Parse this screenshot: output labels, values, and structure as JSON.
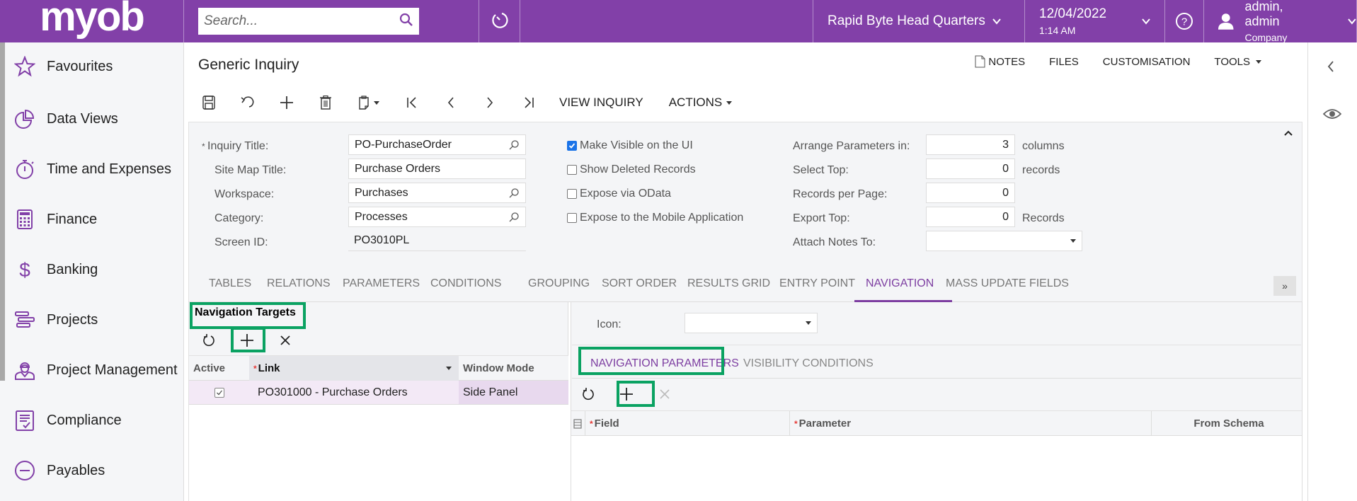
{
  "topbar": {
    "logo": "myob",
    "search_placeholder": "Search...",
    "branch": "Rapid Byte Head Quarters",
    "date": "12/04/2022",
    "time": "1:14 AM",
    "user_name": "admin, admin",
    "user_company": "Company",
    "brand_color": "#8240a8"
  },
  "sidebar": {
    "items": [
      {
        "label": "Favourites",
        "icon": "star-icon"
      },
      {
        "label": "Data Views",
        "icon": "pie-chart-icon"
      },
      {
        "label": "Time and Expenses",
        "icon": "stopwatch-icon"
      },
      {
        "label": "Finance",
        "icon": "calculator-icon"
      },
      {
        "label": "Banking",
        "icon": "dollar-icon"
      },
      {
        "label": "Projects",
        "icon": "gantt-icon"
      },
      {
        "label": "Project Management",
        "icon": "worker-icon"
      },
      {
        "label": "Compliance",
        "icon": "checklist-icon"
      },
      {
        "label": "Payables",
        "icon": "minus-circle-icon"
      }
    ]
  },
  "page": {
    "title": "Generic Inquiry",
    "top_actions": {
      "notes": "NOTES",
      "files": "FILES",
      "customisation": "CUSTOMISATION",
      "tools": "TOOLS"
    },
    "toolbar": {
      "view_inquiry": "VIEW INQUIRY",
      "actions": "ACTIONS"
    }
  },
  "form": {
    "inquiry_title_label": "Inquiry Title:",
    "inquiry_title_value": "PO-PurchaseOrder",
    "site_map_title_label": "Site Map Title:",
    "site_map_title_value": "Purchase Orders",
    "workspace_label": "Workspace:",
    "workspace_value": "Purchases",
    "category_label": "Category:",
    "category_value": "Processes",
    "screen_id_label": "Screen ID:",
    "screen_id_value": "PO3010PL",
    "checkboxes": [
      {
        "label": "Make Visible on the UI",
        "checked": true
      },
      {
        "label": "Show Deleted Records",
        "checked": false
      },
      {
        "label": "Expose via OData",
        "checked": false
      },
      {
        "label": "Expose to the Mobile Application",
        "checked": false
      }
    ],
    "arrange_label": "Arrange Parameters in:",
    "arrange_value": "3",
    "arrange_suffix": "columns",
    "select_top_label": "Select Top:",
    "select_top_value": "0",
    "select_top_suffix": "records",
    "records_per_page_label": "Records per Page:",
    "records_per_page_value": "0",
    "export_top_label": "Export Top:",
    "export_top_value": "0",
    "export_top_suffix": "Records",
    "attach_notes_label": "Attach Notes To:",
    "attach_notes_value": ""
  },
  "tabs": [
    {
      "label": "TABLES"
    },
    {
      "label": "RELATIONS"
    },
    {
      "label": "PARAMETERS"
    },
    {
      "label": "CONDITIONS"
    },
    {
      "label": "GROUPING"
    },
    {
      "label": "SORT ORDER"
    },
    {
      "label": "RESULTS GRID"
    },
    {
      "label": "ENTRY POINT"
    },
    {
      "label": "NAVIGATION",
      "active": true
    },
    {
      "label": "MASS UPDATE FIELDS"
    }
  ],
  "nav_targets": {
    "title": "Navigation Targets",
    "columns": [
      "Active",
      "Link",
      "Window Mode"
    ],
    "rows": [
      {
        "active": true,
        "link": "PO301000 - Purchase Orders",
        "window_mode": "Side Panel"
      }
    ]
  },
  "nav_detail": {
    "icon_label": "Icon:",
    "icon_value": "",
    "subtabs": [
      {
        "label": "NAVIGATION PARAMETERS",
        "active": true
      },
      {
        "label": "VISIBILITY CONDITIONS"
      }
    ],
    "columns": [
      "Field",
      "Parameter",
      "From Schema"
    ],
    "rows": []
  },
  "highlight_color": "#0aa262"
}
